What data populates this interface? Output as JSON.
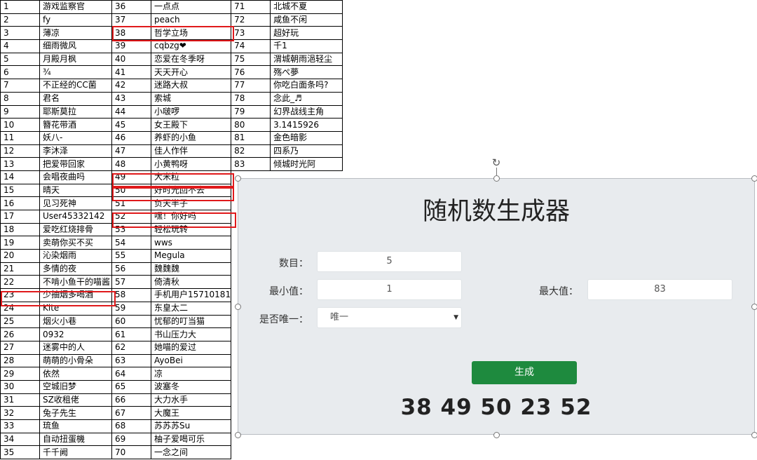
{
  "sheet": {
    "rows": [
      [
        "1",
        "游戏监察官",
        "36",
        "一点点",
        "71",
        "北城不夏"
      ],
      [
        "2",
        "fy",
        "37",
        "peach",
        "72",
        "咸鱼不闲"
      ],
      [
        "3",
        "薄凉",
        "38",
        "哲学立场",
        "73",
        "超好玩"
      ],
      [
        "4",
        "细雨微风",
        "39",
        "cqbzg❤",
        "74",
        "千1"
      ],
      [
        "5",
        "月殿月枫",
        "40",
        "恋爱在冬季呀",
        "75",
        "渭城朝雨浥轻尘"
      ],
      [
        "6",
        "¾",
        "41",
        "天天开心",
        "76",
        "殇ぺ夢"
      ],
      [
        "7",
        "不正经的CC菌",
        "42",
        "迷路大叔",
        "77",
        "你吃白面条吗?"
      ],
      [
        "8",
        "君名",
        "43",
        "索城",
        "78",
        "念此_♬"
      ],
      [
        "9",
        "耶斯莫拉",
        "44",
        "小啵啰",
        "79",
        "幻界战线主角"
      ],
      [
        "10",
        "簪花带酒",
        "45",
        "女王殿下",
        "80",
        "3.1415926"
      ],
      [
        "11",
        "妖八-",
        "46",
        "养虾的小鱼",
        "81",
        "金色暗影"
      ],
      [
        "12",
        "李沐泽",
        "47",
        "佳人作伴",
        "82",
        "四系乃"
      ],
      [
        "13",
        "把爱带回家",
        "48",
        "小黄鸭呀",
        "83",
        "倾城时光阿"
      ],
      [
        "14",
        "会唱夜曲吗",
        "49",
        "大米粒",
        "",
        ""
      ],
      [
        "15",
        "晴天",
        "50",
        "好时光回不去",
        "",
        ""
      ],
      [
        "16",
        "见习死神",
        "51",
        "负天半子",
        "",
        ""
      ],
      [
        "17",
        "User45332142",
        "52",
        "嘿！你好吗",
        "",
        ""
      ],
      [
        "18",
        "爱吃红烧排骨",
        "53",
        "轻松玩转",
        "",
        ""
      ],
      [
        "19",
        "卖萌你买不买",
        "54",
        "wws",
        "",
        ""
      ],
      [
        "20",
        "沁染烟雨",
        "55",
        "Megula",
        "",
        ""
      ],
      [
        "21",
        "多情的夜",
        "56",
        "魏魏魏",
        "",
        ""
      ],
      [
        "22",
        "不啃小鱼干的喵酱",
        "57",
        "倚清秋",
        "",
        ""
      ],
      [
        "23",
        "少抽烟多喝酒",
        "58",
        "手机用户15710181",
        "",
        ""
      ],
      [
        "24",
        "Kite",
        "59",
        "东皇太二",
        "",
        ""
      ],
      [
        "25",
        "烟火小巷",
        "60",
        "忧郁的叮当猫",
        "",
        ""
      ],
      [
        "26",
        "0932",
        "61",
        "书山压力大",
        "",
        ""
      ],
      [
        "27",
        "迷雾中的人",
        "62",
        "她喵的爱过",
        "",
        ""
      ],
      [
        "28",
        "萌萌的小骨朵",
        "63",
        "AyoBei",
        "",
        ""
      ],
      [
        "29",
        "依然",
        "64",
        "凉",
        "",
        ""
      ],
      [
        "30",
        "空城旧梦",
        "65",
        "波塞冬",
        "",
        ""
      ],
      [
        "31",
        "SZ收租佬",
        "66",
        "大力水手",
        "",
        ""
      ],
      [
        "32",
        "兔子先生",
        "67",
        "大魔王",
        "",
        ""
      ],
      [
        "33",
        "琉鱼",
        "68",
        "苏苏苏Su",
        "",
        ""
      ],
      [
        "34",
        "自动扭蛋機",
        "69",
        "柚子爱喝可乐",
        "",
        ""
      ],
      [
        "35",
        "千千阙",
        "70",
        "一念之间",
        "",
        ""
      ]
    ]
  },
  "generator": {
    "title": "随机数生成器",
    "count_label": "数目：",
    "count_value": "5",
    "min_label": "最小值：",
    "min_value": "1",
    "max_label": "最大值：",
    "max_value": "83",
    "unique_label": "是否唯一：",
    "unique_value": "唯一",
    "generate_label": "生成",
    "result": "38 49 50 23 52",
    "button_color": "#1e8a3e"
  },
  "highlight_color": "#e0191b"
}
